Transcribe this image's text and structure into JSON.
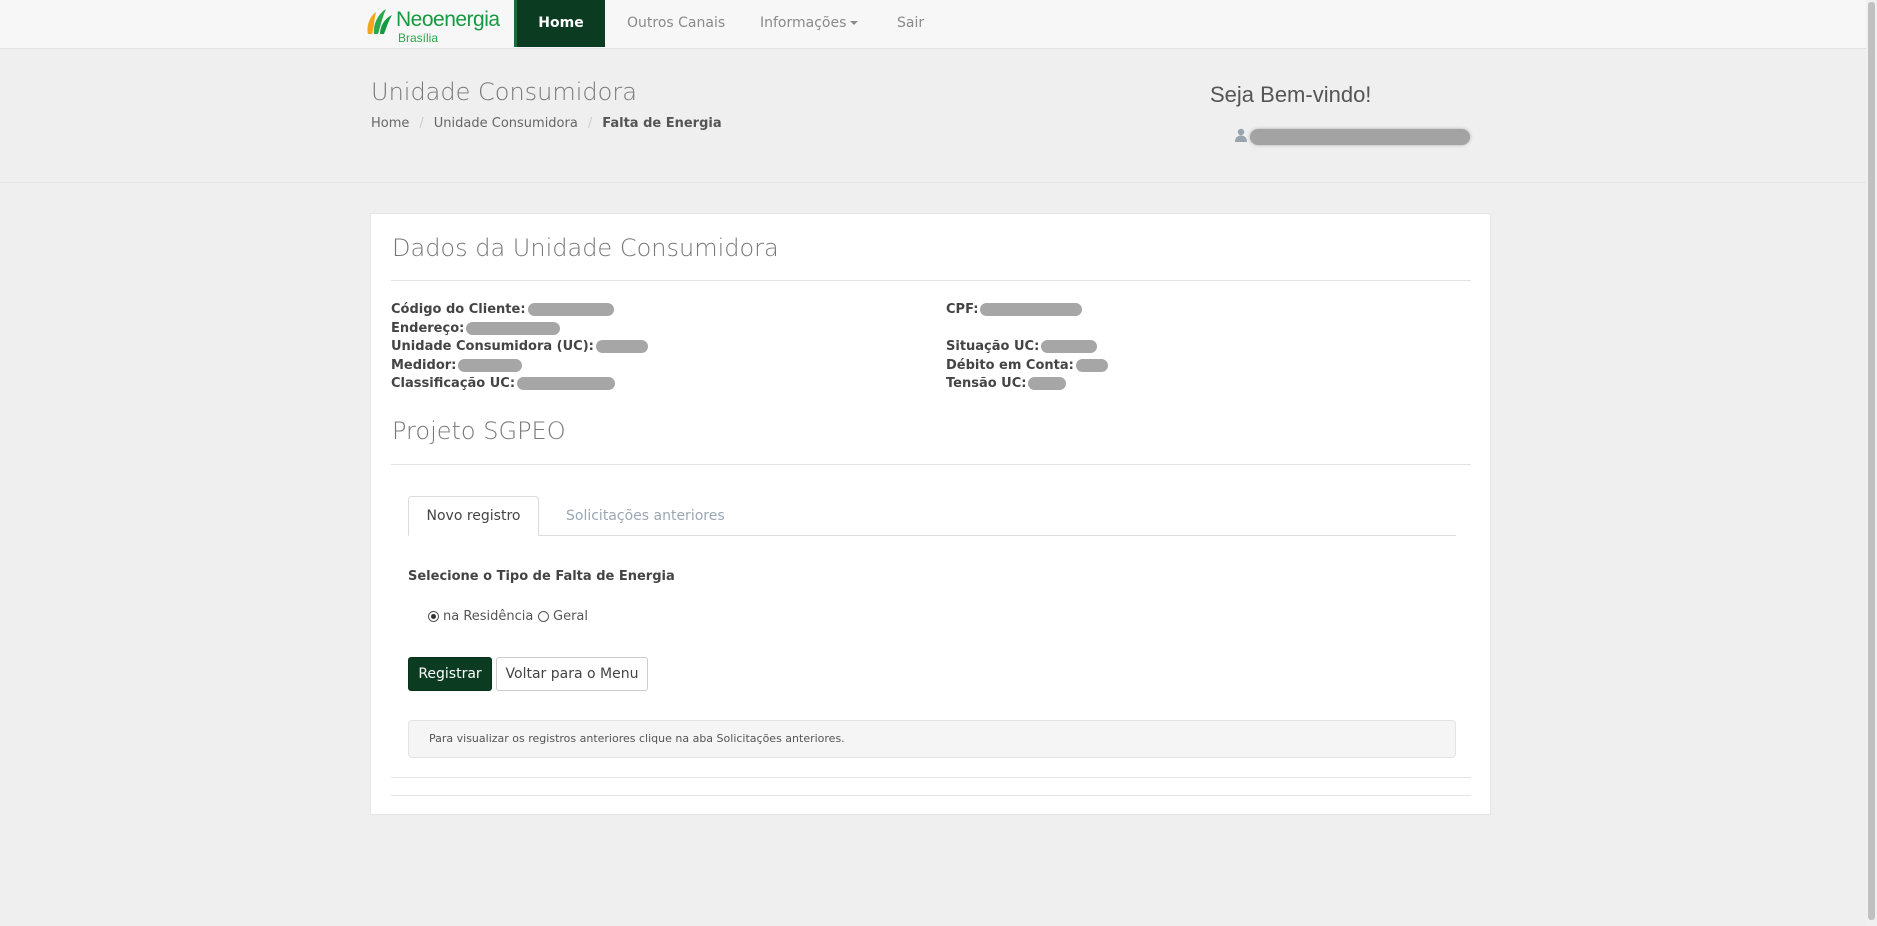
{
  "nav": {
    "logo_name": "Neoenergia",
    "logo_sub": "Brasília",
    "home": "Home",
    "outros_canais": "Outros Canais",
    "informacoes": "Informações",
    "sair": "Sair"
  },
  "header": {
    "title": "Unidade Consumidora",
    "breadcrumb": [
      "Home",
      "Unidade Consumidora",
      "Falta de Energia"
    ],
    "welcome": "Seja Bem-vindo!"
  },
  "dados": {
    "title": "Dados da Unidade Consumidora",
    "left_fields": [
      "Código do Cliente:",
      "Endereço:",
      "Unidade Consumidora (UC):",
      "Medidor:",
      "Classificação UC:"
    ],
    "right_fields": [
      "CPF:",
      "Situação UC:",
      "Débito em Conta:",
      "Tensão UC:"
    ]
  },
  "projeto": {
    "title": "Projeto SGPEO",
    "tabs": [
      "Novo registro",
      "Solicitações anteriores"
    ],
    "select_label": "Selecione o Tipo de Falta de Energia",
    "options": [
      "na Residência",
      "Geral"
    ],
    "selected_option": "na Residência",
    "btn_registrar": "Registrar",
    "btn_voltar": "Voltar para o Menu",
    "info": "Para visualizar os registros anteriores clique na aba Solicitações anteriores."
  },
  "colors": {
    "primary": "#0b3b20",
    "brand_green": "#149a3f"
  }
}
